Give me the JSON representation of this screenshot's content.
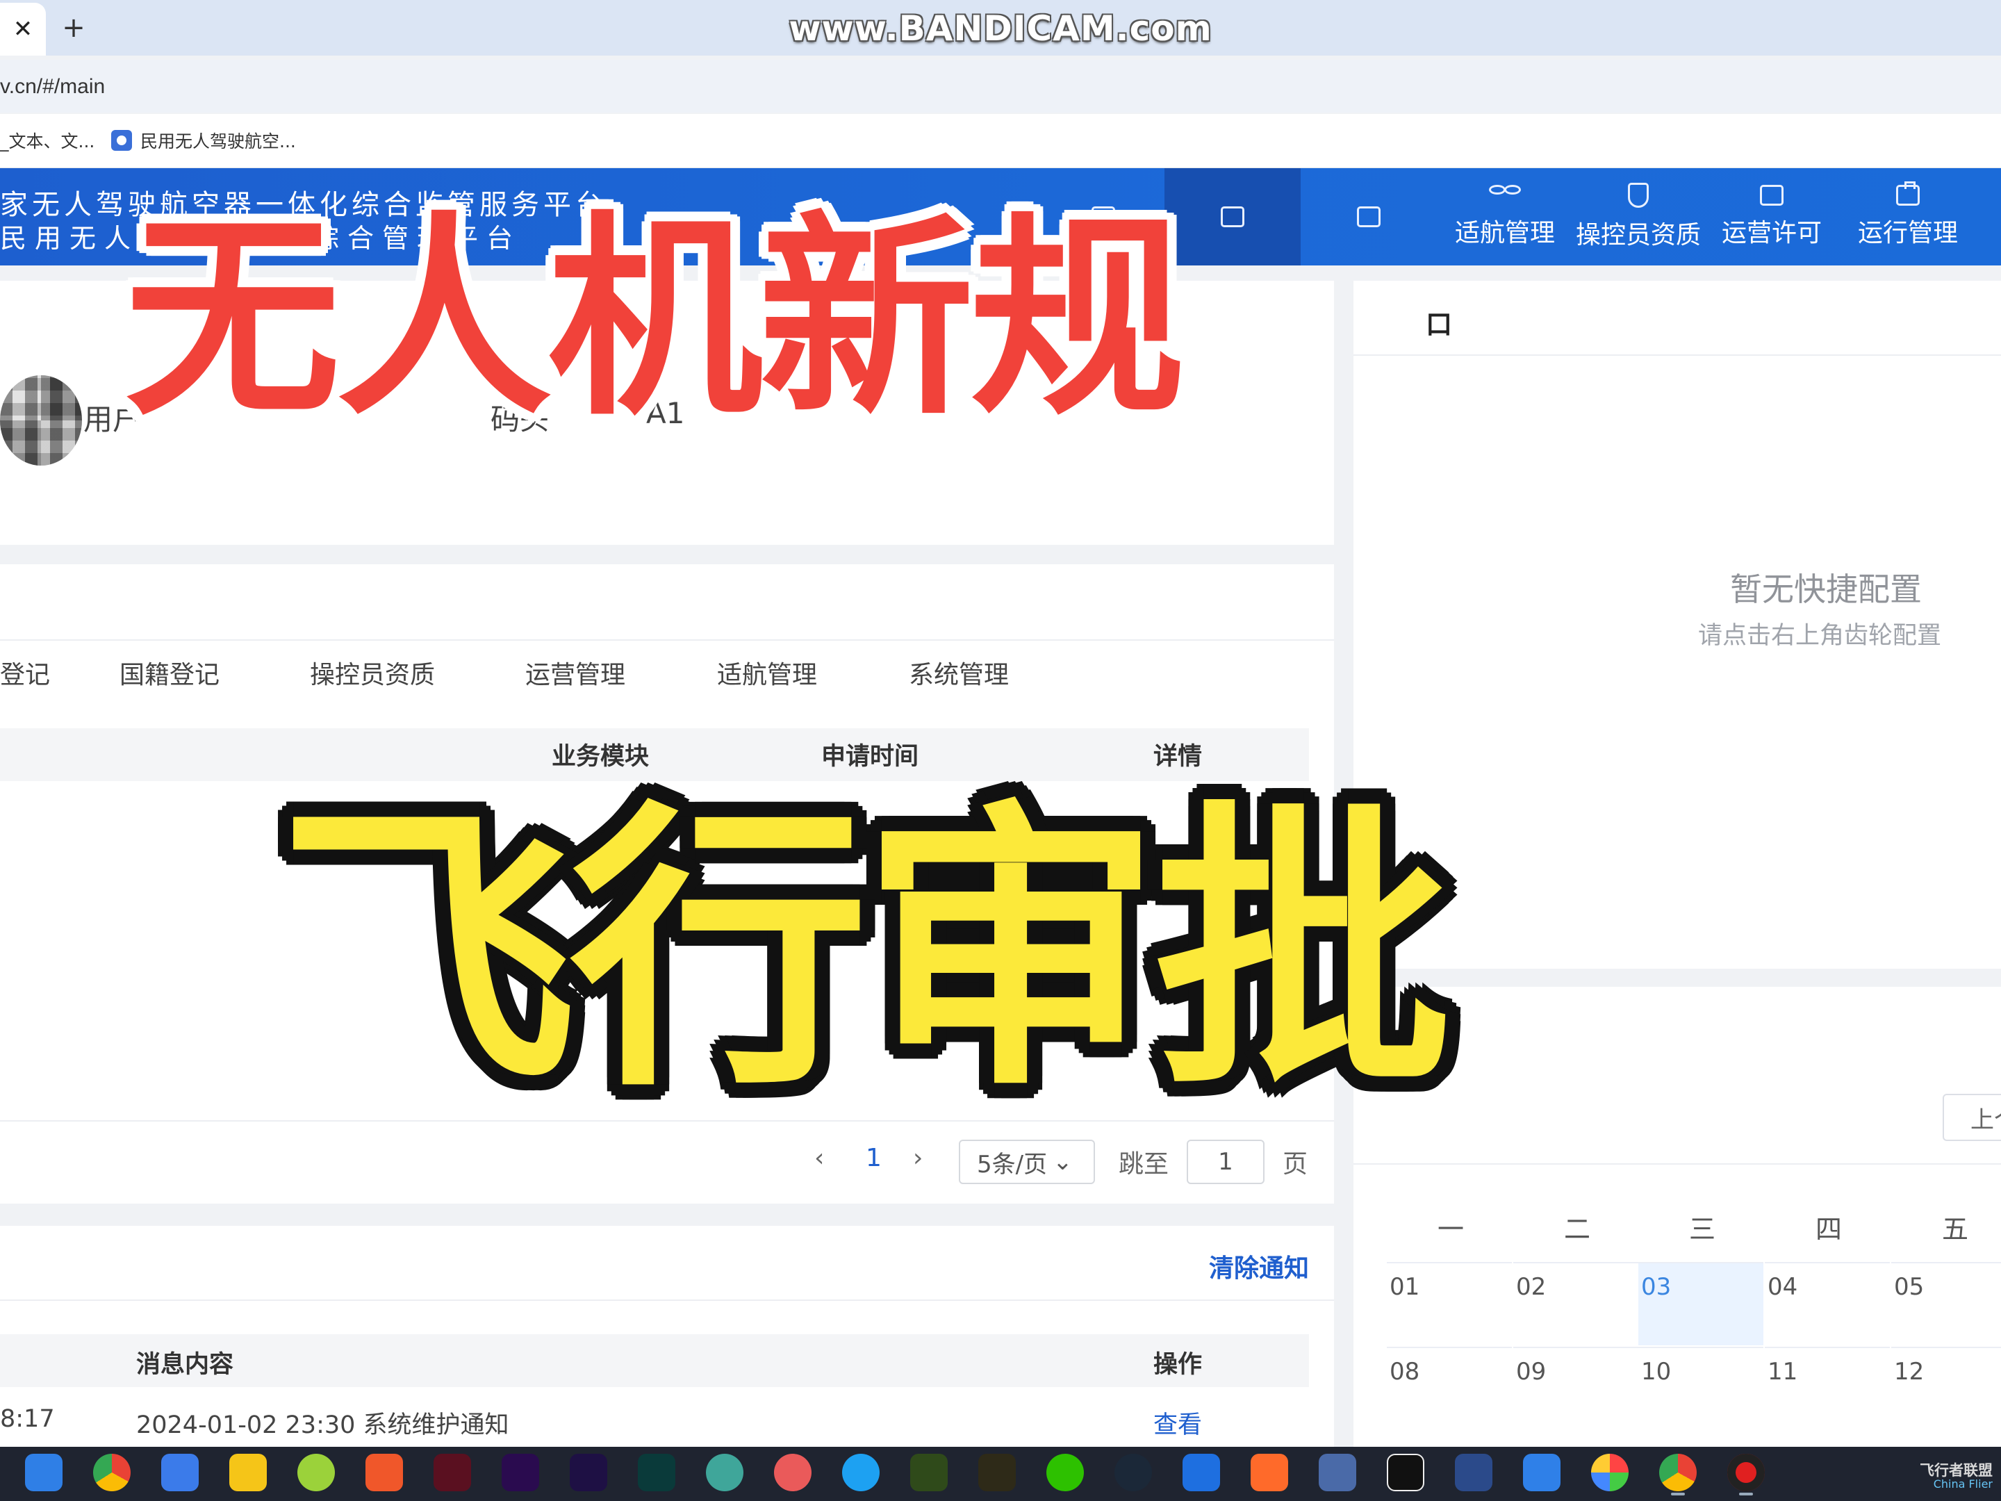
{
  "browser": {
    "tab_close": "✕",
    "new_tab": "+",
    "watermark": "www.BANDICAM.com",
    "url": "v.cn/#/main",
    "bookmarks": [
      {
        "label": "_文本、文...",
        "icon": "document-icon"
      },
      {
        "label": "民用无人驾驶航空...",
        "icon": "site-logo-icon"
      }
    ]
  },
  "app": {
    "title_line1": "家无人驾驶航空器一体化综合监管服务平台",
    "title_line2": "民用无人驾驶航空器综合管理平台",
    "nav": [
      {
        "label": "适航管理",
        "icon": "drone-icon"
      },
      {
        "label": "操控员资质",
        "icon": "shield-icon"
      },
      {
        "label": "运营许可",
        "icon": "id-card-icon"
      },
      {
        "label": "运行管理",
        "icon": "clipboard-icon"
      }
    ]
  },
  "profile": {
    "text_left": "用户",
    "text_mid": "码头",
    "text_right": "A1"
  },
  "todo": {
    "tabs": [
      "登记",
      "国籍登记",
      "操控员资质",
      "运营管理",
      "适航管理",
      "系统管理"
    ],
    "columns": {
      "module": "业务模块",
      "time": "申请时间",
      "detail": "详情"
    },
    "pager": {
      "prev": "‹",
      "page": "1",
      "next": "›",
      "size": "5条/页",
      "jump_label": "跳至",
      "jump_value": "1",
      "page_suffix": "页"
    }
  },
  "notice": {
    "clear": "清除通知",
    "columns": {
      "content": "消息内容",
      "action": "操作"
    },
    "rows": [
      {
        "time": "8:17",
        "content": "2024-01-02 23:30 系统维护通知",
        "action": "查看"
      }
    ]
  },
  "quick": {
    "title": "口",
    "empty_title": "暂无快捷配置",
    "empty_hint": "请点击右上角齿轮配置"
  },
  "calendar": {
    "prev_button": "上个",
    "weekdays": [
      "一",
      "二",
      "三",
      "四",
      "五"
    ],
    "weeks": [
      [
        "01",
        "02",
        "03",
        "04",
        "05"
      ],
      [
        "08",
        "09",
        "10",
        "11",
        "12"
      ]
    ],
    "today": "03"
  },
  "overlay": {
    "headline": "无人机新规",
    "subheadline": "飞行审批"
  },
  "taskbar": {
    "brand_name": "飞行者联盟",
    "brand_en": "China Flier"
  },
  "colors": {
    "header_blue": "#1c69d8",
    "link_blue": "#1f5fce",
    "caption_red": "#f1423a",
    "caption_yellow": "#fce93a"
  }
}
